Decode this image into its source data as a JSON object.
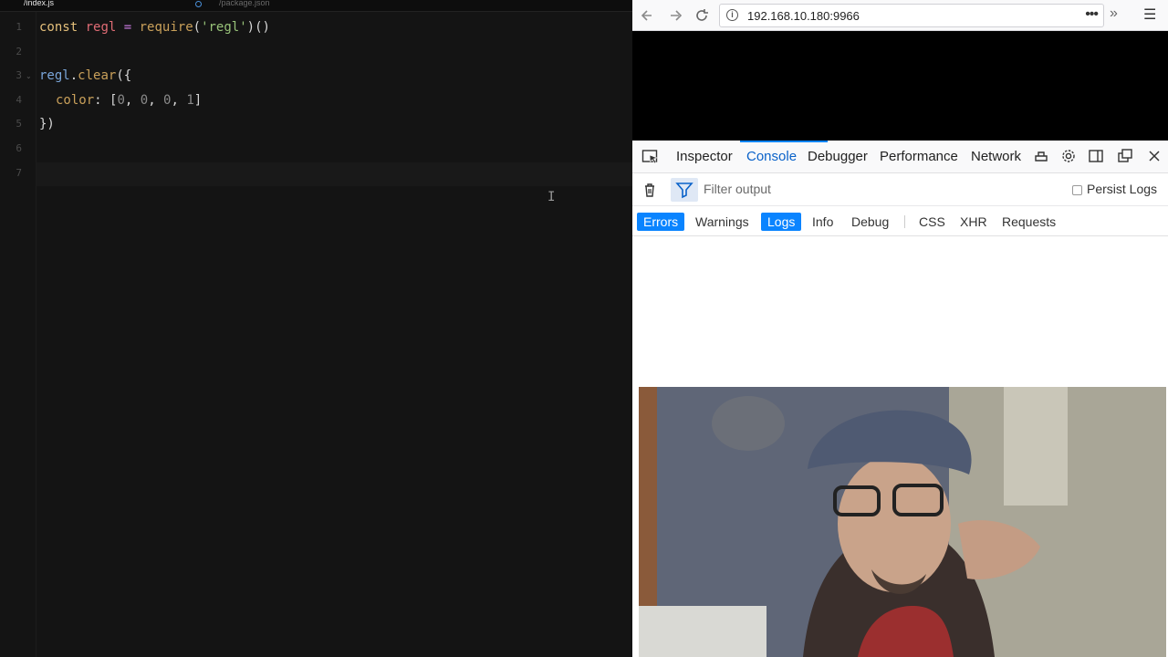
{
  "editor": {
    "tabs": [
      {
        "label": "/index.js",
        "active": true,
        "modified": true
      },
      {
        "label": "/package.json",
        "active": false
      }
    ],
    "line_numbers": [
      "1",
      "2",
      "3",
      "4",
      "5",
      "6",
      "7"
    ],
    "lines": {
      "l1": {
        "kw": "const",
        "var": "regl",
        "eq": "=",
        "fn": "require",
        "p1": "(",
        "str": "'regl'",
        "p2": ")()"
      },
      "l3": {
        "obj": "regl",
        "dot": ".",
        "fn": "clear",
        "rest": "({"
      },
      "l4": {
        "prop": "color",
        "colon": ": [",
        "n1": "0",
        "c1": ", ",
        "n2": "0",
        "c2": ", ",
        "n3": "0",
        "c3": ", ",
        "n4": "1",
        "end": "]"
      },
      "l5": {
        "text": "})"
      }
    },
    "colors": {
      "background": "#141414",
      "keyword": "#e5c07b",
      "variable": "#e06c75",
      "string": "#98c379"
    }
  },
  "browser": {
    "nav": {
      "back_icon": "arrow-left-icon",
      "forward_icon": "arrow-right-icon",
      "reload_icon": "reload-icon",
      "url": "192.168.10.180:9966",
      "page_actions": "•••",
      "overflow": "»",
      "menu": "☰"
    },
    "devtools": {
      "tabs": [
        "Inspector",
        "Console",
        "Debugger",
        "Performance",
        "Network"
      ],
      "active_tab": "Console",
      "filter_placeholder": "Filter output",
      "persist_logs_label": "Persist Logs",
      "levels": [
        {
          "label": "Errors",
          "on": true
        },
        {
          "label": "Warnings",
          "on": false
        },
        {
          "label": "Logs",
          "on": true
        },
        {
          "label": "Info",
          "on": false
        },
        {
          "label": "Debug",
          "on": false
        }
      ],
      "types": [
        "CSS",
        "XHR",
        "Requests"
      ],
      "accent": "#0a84ff"
    }
  }
}
